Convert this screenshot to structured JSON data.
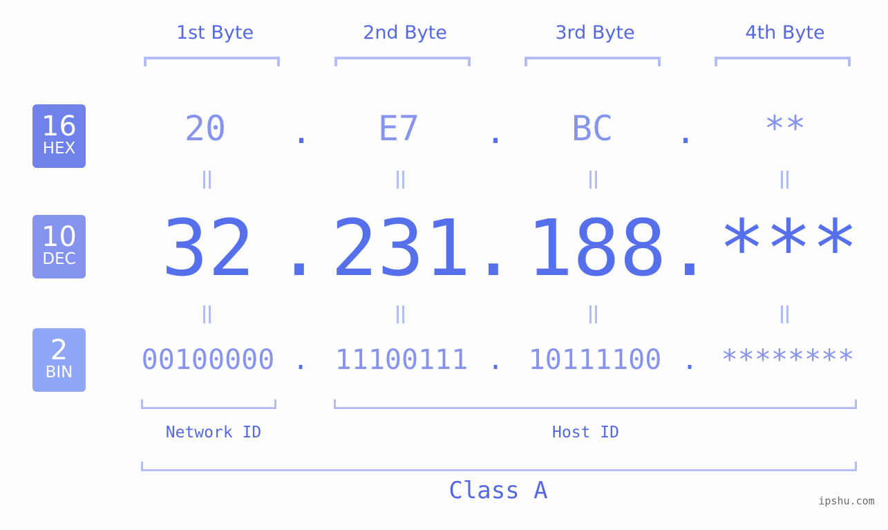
{
  "bytes": {
    "headers": [
      "1st Byte",
      "2nd Byte",
      "3rd Byte",
      "4th Byte"
    ]
  },
  "bases": {
    "hex": {
      "number": "16",
      "label": "HEX",
      "color": "#7082ea"
    },
    "dec": {
      "number": "10",
      "label": "DEC",
      "color": "#8493ee"
    },
    "bin": {
      "number": "2",
      "label": "BIN",
      "color": "#8fa7f6"
    }
  },
  "address": {
    "hex": [
      "20",
      "E7",
      "BC",
      "**"
    ],
    "dec": [
      "32",
      "231",
      "188",
      "***"
    ],
    "bin": [
      "00100000",
      "11100111",
      "10111100",
      "********"
    ],
    "separator": "."
  },
  "segments": {
    "network_label": "Network ID",
    "host_label": "Host ID",
    "class_label": "Class A"
  },
  "watermark": "ipshu.com",
  "colors": {
    "accent": "#5670ec",
    "light": "#8794ec",
    "bracket": "#b3bcf5",
    "label": "#5468e3"
  }
}
